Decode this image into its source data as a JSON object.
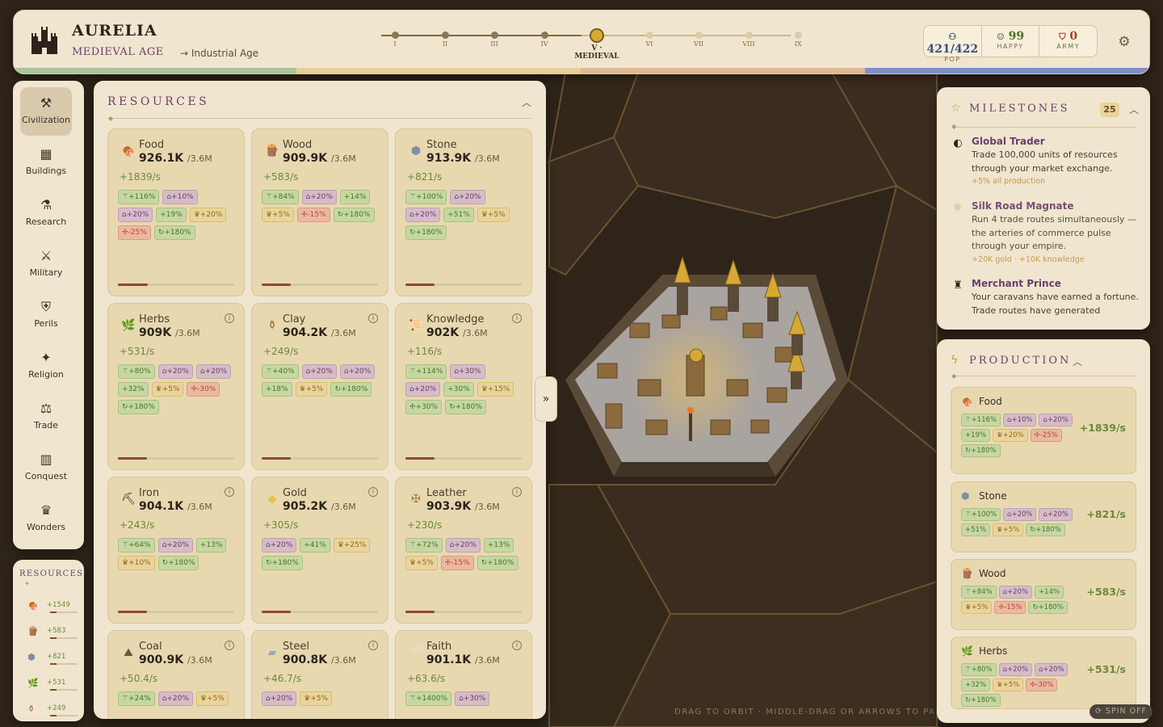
{
  "header": {
    "civ_name": "AURELIA",
    "age_name": "MEDIEVAL AGE",
    "next_age": "→ Industrial Age",
    "ages": [
      {
        "label": "I",
        "state": "past"
      },
      {
        "label": "II",
        "state": "past"
      },
      {
        "label": "III",
        "state": "past"
      },
      {
        "label": "IV",
        "state": "past"
      },
      {
        "label": "V · MEDIEVAL",
        "state": "current"
      },
      {
        "label": "VI",
        "state": "future"
      },
      {
        "label": "VII",
        "state": "future"
      },
      {
        "label": "VIII",
        "state": "future"
      },
      {
        "label": "IX",
        "state": "future"
      }
    ],
    "stats": {
      "pop_value": "421/422",
      "pop_label": "POP",
      "pop_icon": "people-icon",
      "happy_value": "99",
      "happy_label": "HAPPY",
      "happy_icon": "smile-icon",
      "army_value": "0",
      "army_label": "ARMY",
      "army_icon": "shield-icon"
    },
    "settings_icon": "gear-icon"
  },
  "sidebar": {
    "items": [
      {
        "label": "Civilization",
        "icon": "pickaxe-icon",
        "glyph": "⚒",
        "active": true
      },
      {
        "label": "Buildings",
        "icon": "building-icon",
        "glyph": "▦"
      },
      {
        "label": "Research",
        "icon": "flask-icon",
        "glyph": "⚗"
      },
      {
        "label": "Military",
        "icon": "crossed-swords-icon",
        "glyph": "⚔"
      },
      {
        "label": "Perils",
        "icon": "danger-shield-icon",
        "glyph": "⛨"
      },
      {
        "label": "Religion",
        "icon": "sparkle-icon",
        "glyph": "✦"
      },
      {
        "label": "Trade",
        "icon": "cart-icon",
        "glyph": "⚖"
      },
      {
        "label": "Conquest",
        "icon": "map-icon",
        "glyph": "▥"
      },
      {
        "label": "Wonders",
        "icon": "crown-icon",
        "glyph": "♛"
      }
    ]
  },
  "mini_resources": {
    "title": "RESOURCES",
    "items": [
      {
        "icon": "meat-icon",
        "glyph": "🍖",
        "value": "+1549",
        "color": "#c0432b"
      },
      {
        "icon": "wood-icon",
        "glyph": "🪵",
        "value": "+583",
        "color": "#a0683a"
      },
      {
        "icon": "stone-icon",
        "glyph": "⬢",
        "value": "+821",
        "color": "#7f8fa6"
      },
      {
        "icon": "herbs-icon",
        "glyph": "🌿",
        "value": "+531",
        "color": "#5d9a3a"
      },
      {
        "icon": "clay-icon",
        "glyph": "⚱",
        "value": "+249",
        "color": "#b0602a"
      }
    ]
  },
  "resources": {
    "title": "RESOURCES",
    "cards": [
      {
        "name": "Food",
        "amount": "926.1K",
        "cap": "/3.6M",
        "rate": "+1839/s",
        "icon": "meat-icon",
        "glyph": "🍖",
        "color": "#c0432b",
        "progress": 0.26,
        "info": false,
        "chips": [
          {
            "t": "⚚+116%",
            "c": "g"
          },
          {
            "t": "⌂+10%",
            "c": "p"
          },
          {
            "t": "⌂+20%",
            "c": "p"
          },
          {
            "t": "+19%",
            "c": "g"
          },
          {
            "t": "♛+20%",
            "c": "y"
          },
          {
            "t": "✢-25%",
            "c": "r"
          },
          {
            "t": "↻+180%",
            "c": "g"
          }
        ]
      },
      {
        "name": "Wood",
        "amount": "909.9K",
        "cap": "/3.6M",
        "rate": "+583/s",
        "icon": "wood-icon",
        "glyph": "🪵",
        "color": "#a0683a",
        "progress": 0.25,
        "info": false,
        "chips": [
          {
            "t": "⚚+84%",
            "c": "g"
          },
          {
            "t": "⌂+20%",
            "c": "p"
          },
          {
            "t": "+14%",
            "c": "g"
          },
          {
            "t": "♛+5%",
            "c": "y"
          },
          {
            "t": "✢-15%",
            "c": "r"
          },
          {
            "t": "↻+180%",
            "c": "g"
          }
        ]
      },
      {
        "name": "Stone",
        "amount": "913.9K",
        "cap": "/3.6M",
        "rate": "+821/s",
        "icon": "stone-icon",
        "glyph": "⬢",
        "color": "#7f8fa6",
        "progress": 0.25,
        "info": false,
        "chips": [
          {
            "t": "⚚+100%",
            "c": "g"
          },
          {
            "t": "⌂+20%",
            "c": "p"
          },
          {
            "t": "⌂+20%",
            "c": "p"
          },
          {
            "t": "+51%",
            "c": "g"
          },
          {
            "t": "♛+5%",
            "c": "y"
          },
          {
            "t": "↻+180%",
            "c": "g"
          }
        ]
      },
      {
        "name": "Herbs",
        "amount": "909K",
        "cap": "/3.6M",
        "rate": "+531/s",
        "icon": "herbs-icon",
        "glyph": "🌿",
        "color": "#5d9a3a",
        "progress": 0.25,
        "info": true,
        "chips": [
          {
            "t": "⚚+80%",
            "c": "g"
          },
          {
            "t": "⌂+20%",
            "c": "p"
          },
          {
            "t": "⌂+20%",
            "c": "p"
          },
          {
            "t": "+32%",
            "c": "g"
          },
          {
            "t": "♛+5%",
            "c": "y"
          },
          {
            "t": "✢-30%",
            "c": "r"
          },
          {
            "t": "↻+180%",
            "c": "g"
          }
        ]
      },
      {
        "name": "Clay",
        "amount": "904.2K",
        "cap": "/3.6M",
        "rate": "+249/s",
        "icon": "clay-icon",
        "glyph": "⚱",
        "color": "#b0602a",
        "progress": 0.25,
        "info": true,
        "chips": [
          {
            "t": "⚚+40%",
            "c": "g"
          },
          {
            "t": "⌂+20%",
            "c": "p"
          },
          {
            "t": "⌂+20%",
            "c": "p"
          },
          {
            "t": "+18%",
            "c": "g"
          },
          {
            "t": "♛+5%",
            "c": "y"
          },
          {
            "t": "↻+180%",
            "c": "g"
          }
        ]
      },
      {
        "name": "Knowledge",
        "amount": "902K",
        "cap": "/3.6M",
        "rate": "+116/s",
        "icon": "scroll-icon",
        "glyph": "📜",
        "color": "#d8b25a",
        "progress": 0.25,
        "info": true,
        "chips": [
          {
            "t": "⚚+114%",
            "c": "g"
          },
          {
            "t": "⌂+30%",
            "c": "p"
          },
          {
            "t": "⌂+20%",
            "c": "p"
          },
          {
            "t": "+30%",
            "c": "g"
          },
          {
            "t": "♛+15%",
            "c": "y"
          },
          {
            "t": "✢+30%",
            "c": "g"
          },
          {
            "t": "↻+180%",
            "c": "g"
          }
        ]
      },
      {
        "name": "Iron",
        "amount": "904.1K",
        "cap": "/3.6M",
        "rate": "+243/s",
        "icon": "iron-ore-icon",
        "glyph": "⛏",
        "color": "#2c241a",
        "progress": 0.25,
        "info": true,
        "chips": [
          {
            "t": "⚚+64%",
            "c": "g"
          },
          {
            "t": "⌂+20%",
            "c": "p"
          },
          {
            "t": "+13%",
            "c": "g"
          },
          {
            "t": "♛+10%",
            "c": "y"
          },
          {
            "t": "↻+180%",
            "c": "g"
          }
        ]
      },
      {
        "name": "Gold",
        "amount": "905.2K",
        "cap": "/3.6M",
        "rate": "+305/s",
        "icon": "gold-icon",
        "glyph": "◆",
        "color": "#e6c24a",
        "progress": 0.25,
        "info": true,
        "chips": [
          {
            "t": "⌂+20%",
            "c": "p"
          },
          {
            "t": "+41%",
            "c": "g"
          },
          {
            "t": "♛+25%",
            "c": "y"
          },
          {
            "t": "↻+180%",
            "c": "g"
          }
        ]
      },
      {
        "name": "Leather",
        "amount": "903.9K",
        "cap": "/3.6M",
        "rate": "+230/s",
        "icon": "hide-icon",
        "glyph": "✠",
        "color": "#b0803a",
        "progress": 0.25,
        "info": true,
        "chips": [
          {
            "t": "⚚+72%",
            "c": "g"
          },
          {
            "t": "⌂+20%",
            "c": "p"
          },
          {
            "t": "+13%",
            "c": "g"
          },
          {
            "t": "♛+5%",
            "c": "y"
          },
          {
            "t": "✢-15%",
            "c": "r"
          },
          {
            "t": "↻+180%",
            "c": "g"
          }
        ]
      },
      {
        "name": "Coal",
        "amount": "900.9K",
        "cap": "/3.6M",
        "rate": "+50.4/s",
        "icon": "coal-icon",
        "glyph": "⛰",
        "color": "#6b5a3e",
        "progress": 0.25,
        "info": true,
        "chips": [
          {
            "t": "⚚+24%",
            "c": "g"
          },
          {
            "t": "⌂+20%",
            "c": "p"
          },
          {
            "t": "♛+5%",
            "c": "y"
          }
        ]
      },
      {
        "name": "Steel",
        "amount": "900.8K",
        "cap": "/3.6M",
        "rate": "+46.7/s",
        "icon": "steel-icon",
        "glyph": "▰",
        "color": "#9aa8b8",
        "progress": 0.25,
        "info": true,
        "chips": [
          {
            "t": "⌂+20%",
            "c": "p"
          },
          {
            "t": "♛+5%",
            "c": "y"
          }
        ]
      },
      {
        "name": "Faith",
        "amount": "901.1K",
        "cap": "/3.6M",
        "rate": "+63.6/s",
        "icon": "dove-icon",
        "glyph": "🕊",
        "color": "#e8e0c8",
        "progress": 0.25,
        "info": true,
        "chips": [
          {
            "t": "⚚+1400%",
            "c": "g"
          },
          {
            "t": "⌂+30%",
            "c": "p"
          }
        ]
      }
    ]
  },
  "expand_label": "»",
  "milestones": {
    "title": "MILESTONES",
    "count": "25",
    "items": [
      {
        "title": "Global Trader",
        "desc": "Trade 100,000 units of resources through your market exchange.",
        "reward": "+5% all production",
        "icon": "globe-icon",
        "glyph": "◐"
      },
      {
        "title": "Silk Road Magnate",
        "desc": "Run 4 trade routes simultaneously — the arteries of commerce pulse through your empire.",
        "reward": "+20K gold · +10K knowledge",
        "icon": "sun-icon",
        "glyph": "✺"
      },
      {
        "title": "Merchant Prince",
        "desc": "Your caravans have earned a fortune. Trade routes have generated",
        "reward": "",
        "icon": "merchant-icon",
        "glyph": "♜"
      }
    ]
  },
  "production": {
    "title": "PRODUCTION",
    "items": [
      {
        "name": "Food",
        "rate": "+1839/s",
        "icon": "meat-icon",
        "glyph": "🍖",
        "color": "#c0432b",
        "chips": [
          {
            "t": "⚚+116%",
            "c": "g"
          },
          {
            "t": "⌂+10%",
            "c": "p"
          },
          {
            "t": "⌂+20%",
            "c": "p"
          },
          {
            "t": "+19%",
            "c": "g"
          },
          {
            "t": "♛+20%",
            "c": "y"
          },
          {
            "t": "✢-25%",
            "c": "r"
          },
          {
            "t": "↻+180%",
            "c": "g"
          }
        ]
      },
      {
        "name": "Stone",
        "rate": "+821/s",
        "icon": "stone-icon",
        "glyph": "⬢",
        "color": "#7f8fa6",
        "chips": [
          {
            "t": "⚚+100%",
            "c": "g"
          },
          {
            "t": "⌂+20%",
            "c": "p"
          },
          {
            "t": "⌂+20%",
            "c": "p"
          },
          {
            "t": "+51%",
            "c": "g"
          },
          {
            "t": "♛+5%",
            "c": "y"
          },
          {
            "t": "↻+180%",
            "c": "g"
          }
        ]
      },
      {
        "name": "Wood",
        "rate": "+583/s",
        "icon": "wood-icon",
        "glyph": "🪵",
        "color": "#a0683a",
        "chips": [
          {
            "t": "⚚+84%",
            "c": "g"
          },
          {
            "t": "⌂+20%",
            "c": "p"
          },
          {
            "t": "+14%",
            "c": "g"
          },
          {
            "t": "♛+5%",
            "c": "y"
          },
          {
            "t": "✢-15%",
            "c": "r"
          },
          {
            "t": "↻+180%",
            "c": "g"
          }
        ]
      },
      {
        "name": "Herbs",
        "rate": "+531/s",
        "icon": "herbs-icon",
        "glyph": "🌿",
        "color": "#5d9a3a",
        "chips": [
          {
            "t": "⚚+80%",
            "c": "g"
          },
          {
            "t": "⌂+20%",
            "c": "p"
          },
          {
            "t": "⌂+20%",
            "c": "p"
          },
          {
            "t": "+32%",
            "c": "g"
          },
          {
            "t": "♛+5%",
            "c": "y"
          },
          {
            "t": "✢-30%",
            "c": "r"
          },
          {
            "t": "↻+180%",
            "c": "g"
          }
        ]
      }
    ]
  },
  "hint_text": "DRAG TO ORBIT · MIDDLE-DRAG OR ARROWS TO PAN · SCROLL TO ZOOM · CLICK A TILE",
  "spin_label": "⟳ SPIN OFF"
}
